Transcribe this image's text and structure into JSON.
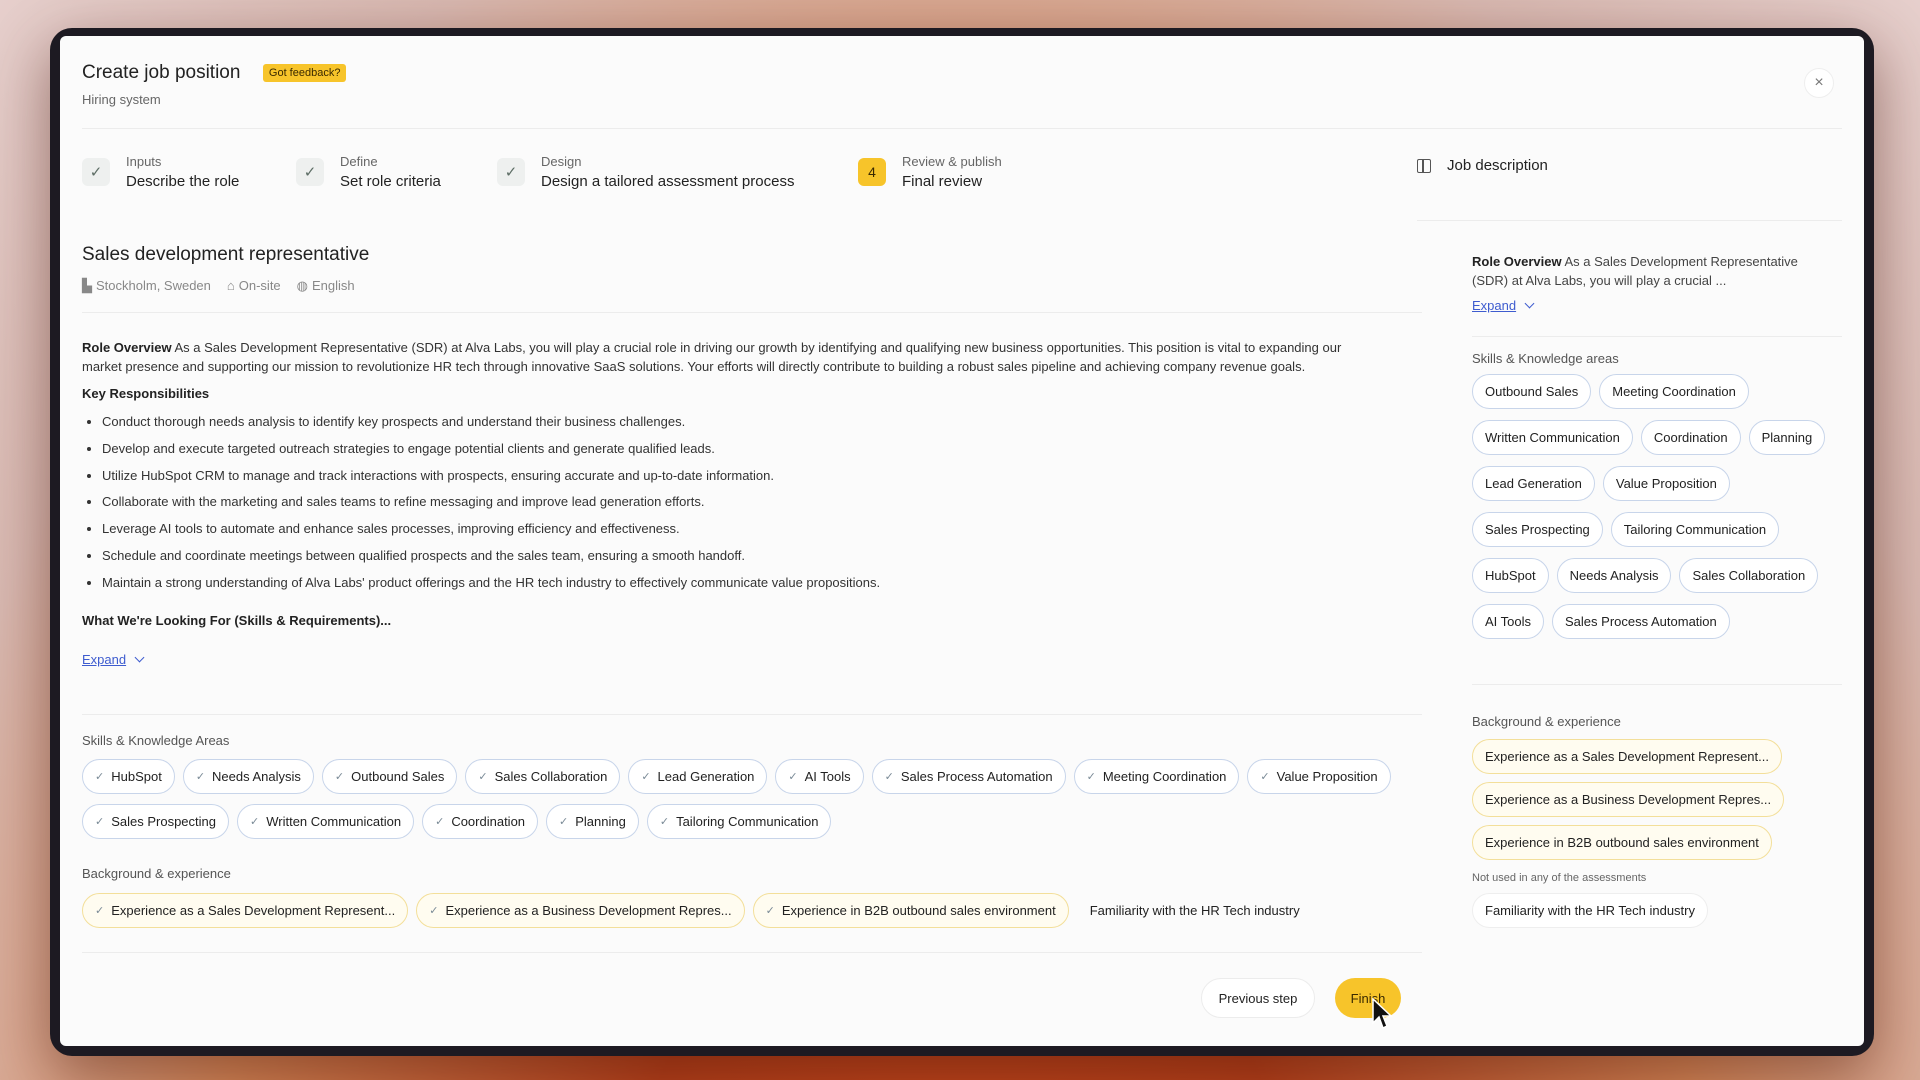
{
  "header": {
    "title": "Create job position",
    "feedback_badge": "Got feedback?",
    "subtitle": "Hiring system",
    "close": "×"
  },
  "steps": [
    {
      "small": "Inputs",
      "big": "Describe the role",
      "icon": "✓"
    },
    {
      "small": "Define",
      "big": "Set role criteria",
      "icon": "✓"
    },
    {
      "small": "Design",
      "big": "Design a tailored assessment process",
      "icon": "✓"
    },
    {
      "small": "Review & publish",
      "big": "Final review",
      "icon": "4"
    }
  ],
  "job_description_label": "Job description",
  "job": {
    "title": "Sales development representative",
    "location": "Stockholm, Sweden",
    "work_mode": "On-site",
    "language": "English"
  },
  "description": {
    "overview_label": "Role Overview",
    "overview_text": " As a Sales Development Representative (SDR) at Alva Labs, you will play a crucial role in driving our growth by identifying and qualifying new business opportunities. This position is vital to expanding our market presence and supporting our mission to revolutionize HR tech through innovative SaaS solutions. Your efforts will directly contribute to building a robust sales pipeline and achieving company revenue goals.",
    "responsibilities_label": "Key Responsibilities",
    "responsibilities": [
      "Conduct thorough needs analysis to identify key prospects and understand their business challenges.",
      "Develop and execute targeted outreach strategies to engage potential clients and generate qualified leads.",
      "Utilize HubSpot CRM to manage and track interactions with prospects, ensuring accurate and up-to-date information.",
      "Collaborate with the marketing and sales teams to refine messaging and improve lead generation efforts.",
      "Leverage AI tools to automate and enhance sales processes, improving efficiency and effectiveness.",
      "Schedule and coordinate meetings between qualified prospects and the sales team, ensuring a smooth handoff.",
      "Maintain a strong understanding of Alva Labs' product offerings and the HR tech industry to effectively communicate value propositions."
    ],
    "looking_for": "What We're Looking For (Skills & Requirements)...",
    "expand": "Expand"
  },
  "skills_label": "Skills & Knowledge Areas",
  "skills_row1": [
    "HubSpot",
    "Needs Analysis",
    "Outbound Sales",
    "Sales Collaboration",
    "Lead Generation",
    "AI Tools",
    "Sales Process Automation",
    "Meeting Coordination"
  ],
  "skills_row2": [
    "Value Proposition",
    "Sales Prospecting",
    "Written Communication",
    "Coordination",
    "Planning",
    "Tailoring Communication"
  ],
  "background_label": "Background & experience",
  "background_items": [
    "Experience as a Sales Development Represent...",
    "Experience as a Business Development Repres...",
    "Experience in B2B outbound sales environment"
  ],
  "background_unused": "Familiarity with the HR Tech industry",
  "footer": {
    "previous": "Previous step",
    "finish": "Finish"
  },
  "right_panel": {
    "overview_label": "Role Overview",
    "overview_text": " As a Sales Development Representative (SDR) at Alva Labs, you will play a crucial ...",
    "expand": "Expand",
    "skills_label": "Skills & Knowledge areas",
    "skills": [
      "Outbound Sales",
      "Meeting Coordination",
      "Written Communication",
      "Coordination",
      "Planning",
      "Lead Generation",
      "Value Proposition",
      "Sales Prospecting",
      "Tailoring Communication",
      "HubSpot",
      "Needs Analysis",
      "Sales Collaboration",
      "AI Tools",
      "Sales Process Automation"
    ],
    "background_label": "Background & experience",
    "background_items": [
      "Experience as a Sales Development Represent...",
      "Experience as a Business Development Repres...",
      "Experience in B2B outbound sales environment"
    ],
    "unused_label": "Not used in any of the assessments",
    "unused_items": [
      "Familiarity with the HR Tech industry"
    ]
  }
}
